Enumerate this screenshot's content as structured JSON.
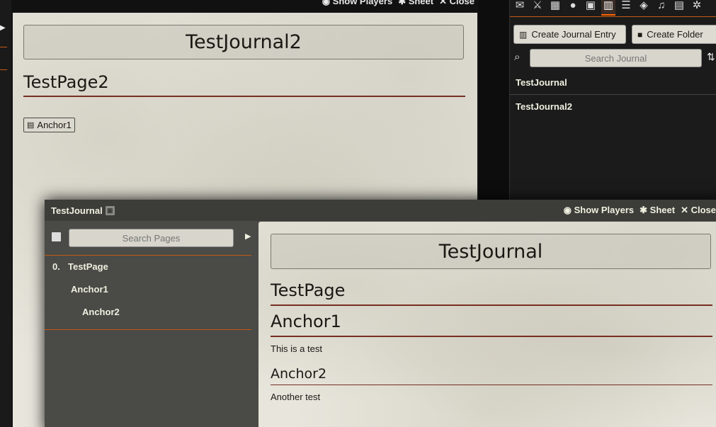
{
  "back_window": {
    "header": {
      "show_players": "◉ Show Players",
      "sheet": "✱ Sheet",
      "close": "✕ Close"
    },
    "journal_title": "TestJournal2",
    "page_title": "TestPage2",
    "anchor_link": "Anchor1"
  },
  "sidebar": {
    "tabs": [
      "chat",
      "combat",
      "scenes",
      "actors",
      "items",
      "journal",
      "tables",
      "cards",
      "playlists",
      "compendium",
      "settings"
    ],
    "active_tab": "journal",
    "create_entry_label": "Create Journal Entry",
    "create_folder_label": "Create Folder",
    "search_placeholder": "Search Journal",
    "entries": [
      "TestJournal",
      "TestJournal2"
    ]
  },
  "front_window": {
    "title": "TestJournal",
    "header": {
      "show_players": "Show Players",
      "sheet": "Sheet",
      "close": "Close"
    },
    "search_placeholder": "Search Pages",
    "toc": [
      {
        "num": "0.",
        "label": "TestPage"
      },
      {
        "num": "",
        "label": "Anchor1"
      },
      {
        "num": "",
        "label": "Anchor2"
      }
    ],
    "journal_title": "TestJournal",
    "page_title": "TestPage",
    "heading1": "Anchor1",
    "text1": "This is a test",
    "heading2": "Anchor2",
    "text2": "Another test"
  },
  "colors": {
    "accent": "#ff6400",
    "heading_rule": "#782e22",
    "parchment": "#e8e6dc"
  }
}
